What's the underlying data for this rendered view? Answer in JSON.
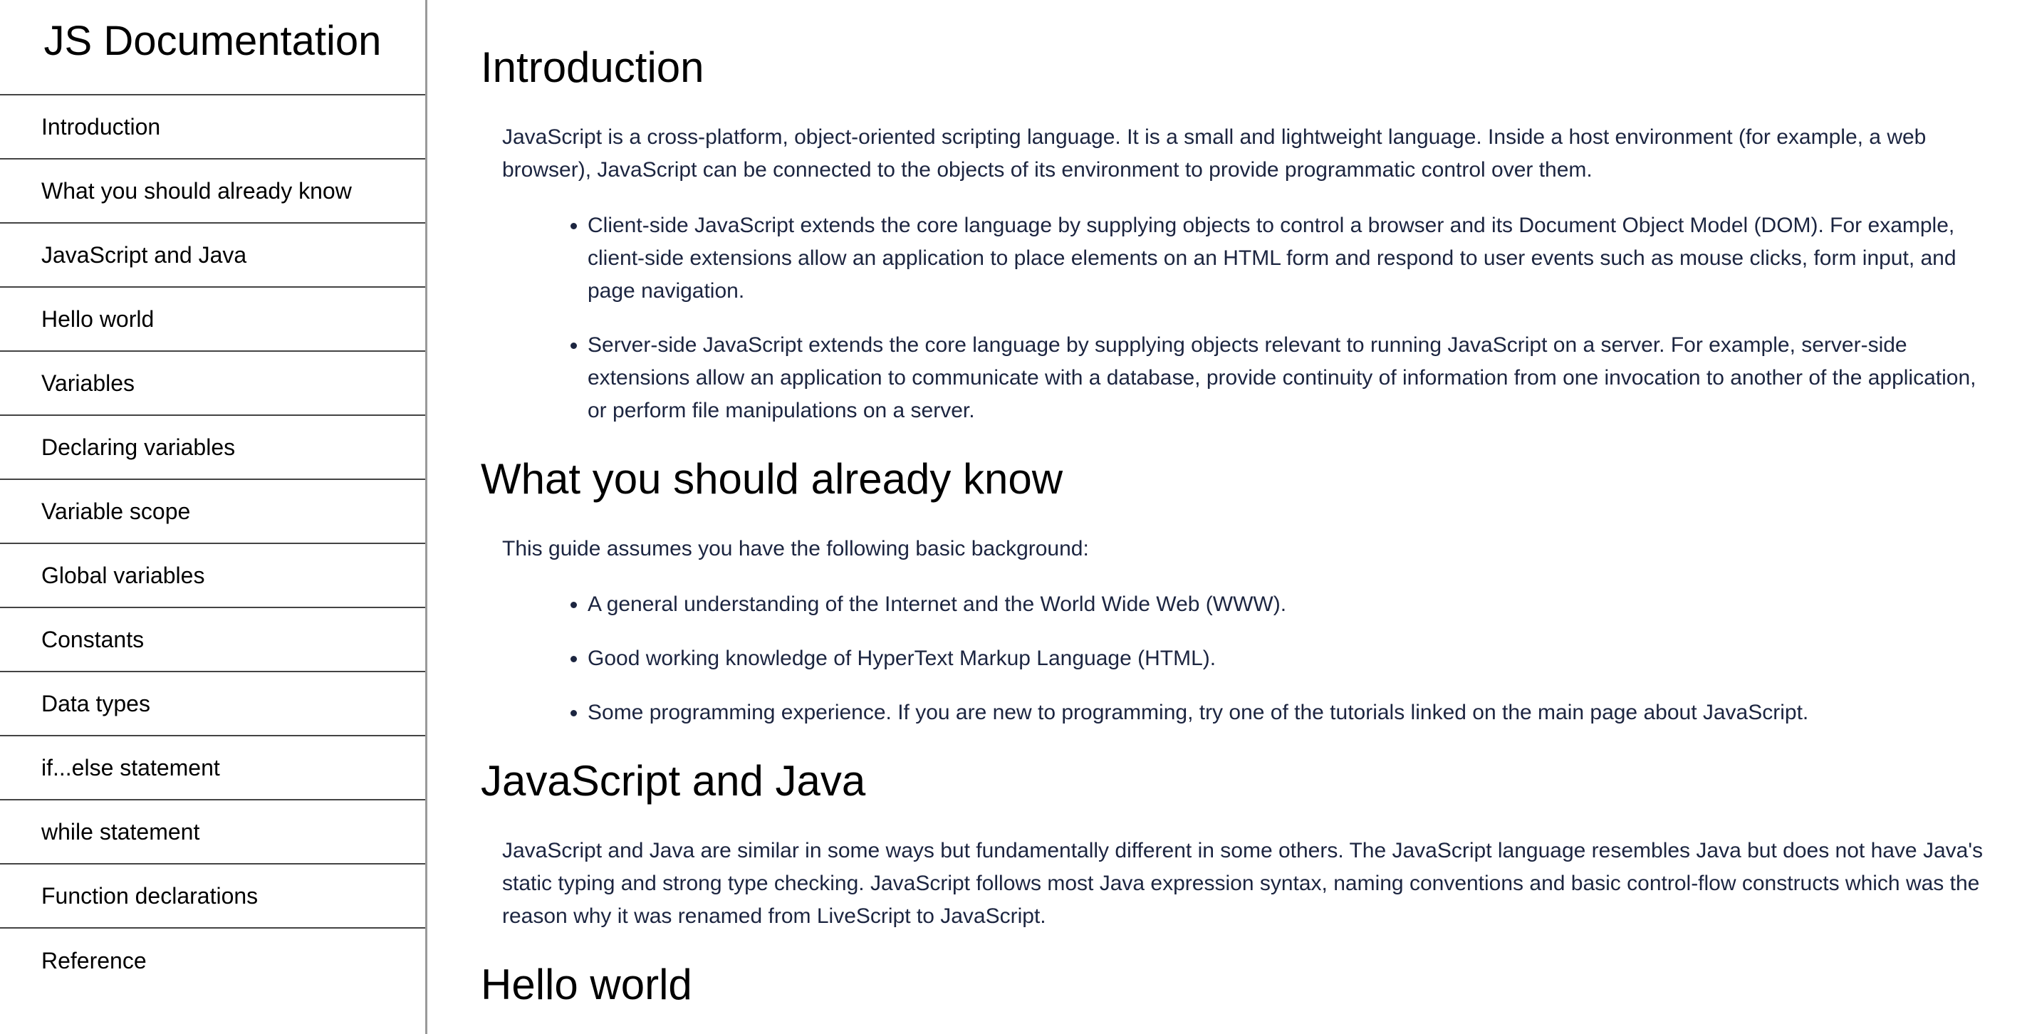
{
  "nav": {
    "title": "JS Documentation",
    "items": [
      "Introduction",
      "What you should already know",
      "JavaScript and Java",
      "Hello world",
      "Variables",
      "Declaring variables",
      "Variable scope",
      "Global variables",
      "Constants",
      "Data types",
      "if...else statement",
      "while statement",
      "Function declarations",
      "Reference"
    ]
  },
  "sections": {
    "intro": {
      "title": "Introduction",
      "paragraph": "JavaScript is a cross-platform, object-oriented scripting language. It is a small and lightweight language. Inside a host environment (for example, a web browser), JavaScript can be connected to the objects of its environment to provide programmatic control over them.",
      "bullets": [
        "Client-side JavaScript extends the core language by supplying objects to control a browser and its Document Object Model (DOM). For example, client-side extensions allow an application to place elements on an HTML form and respond to user events such as mouse clicks, form input, and page navigation.",
        "Server-side JavaScript extends the core language by supplying objects relevant to running JavaScript on a server. For example, server-side extensions allow an application to communicate with a database, provide continuity of information from one invocation to another of the application, or perform file manipulations on a server."
      ]
    },
    "know": {
      "title": "What you should already know",
      "paragraph": "This guide assumes you have the following basic background:",
      "bullets": [
        "A general understanding of the Internet and the World Wide Web (WWW).",
        "Good working knowledge of HyperText Markup Language (HTML).",
        "Some programming experience. If you are new to programming, try one of the tutorials linked on the main page about JavaScript."
      ]
    },
    "java": {
      "title": "JavaScript and Java",
      "paragraph": "JavaScript and Java are similar in some ways but fundamentally different in some others. The JavaScript language resembles Java but does not have Java's static typing and strong type checking. JavaScript follows most Java expression syntax, naming conventions and basic control-flow constructs which was the reason why it was renamed from LiveScript to JavaScript."
    },
    "hello": {
      "title": "Hello world"
    }
  },
  "colors": {
    "body_text": "#1c2540",
    "heading_text": "#000000",
    "nav_border": "#444444",
    "sidebar_divider": "#9a9a9a"
  }
}
